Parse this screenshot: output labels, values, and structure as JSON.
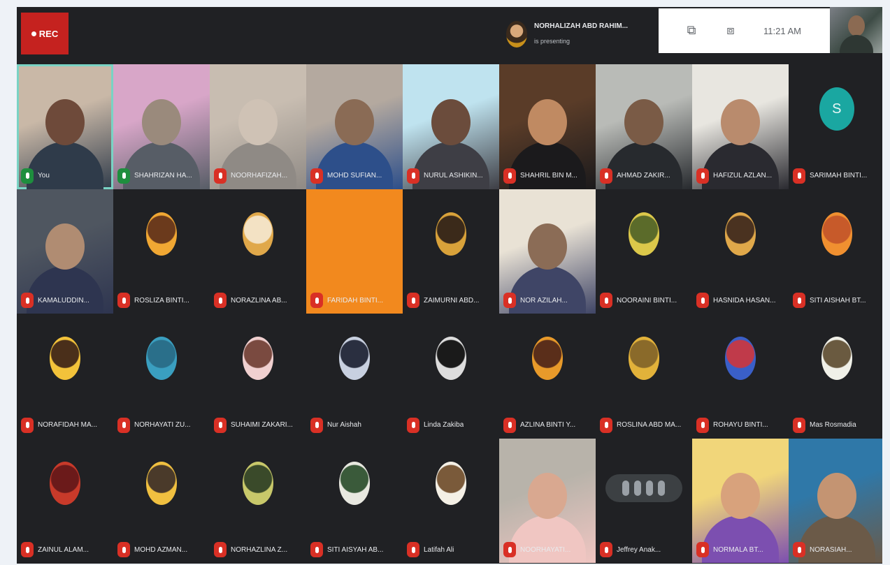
{
  "topbar": {
    "rec_label": "REC",
    "presenter_name": "NORHALIZAH ABD RAHIM...",
    "presenter_status": "is presenting",
    "clock": "11:21 AM",
    "icons": [
      "present-screen-icon",
      "people-icon"
    ]
  },
  "tiles": [
    {
      "name": "You",
      "kind": "video",
      "mic": "on",
      "speaking": true
    },
    {
      "name": "SHAHRIZAN HA...",
      "kind": "video",
      "mic": "on"
    },
    {
      "name": "NOORHAFIZAH...",
      "kind": "video",
      "mic": "off"
    },
    {
      "name": "MOHD SUFIAN...",
      "kind": "video",
      "mic": "off"
    },
    {
      "name": "NURUL ASHIKIN...",
      "kind": "video",
      "mic": "off"
    },
    {
      "name": "SHAHRIL BIN M...",
      "kind": "video",
      "mic": "off"
    },
    {
      "name": "AHMAD ZAKIR...",
      "kind": "video",
      "mic": "off"
    },
    {
      "name": "HAFIZUL AZLAN...",
      "kind": "video",
      "mic": "off"
    },
    {
      "name": "SARIMAH BINTI...",
      "kind": "letter",
      "letter": "S",
      "mic": "off"
    },
    {
      "name": "KAMALUDDIN...",
      "kind": "video",
      "mic": "off"
    },
    {
      "name": "ROSLIZA BINTI...",
      "kind": "avatar",
      "mic": "off"
    },
    {
      "name": "NORAZLINA AB...",
      "kind": "avatar",
      "mic": "off"
    },
    {
      "name": "FARIDAH BINTI...",
      "kind": "orange",
      "mic": "off"
    },
    {
      "name": "ZAIMURNI ABD...",
      "kind": "avatar",
      "mic": "off"
    },
    {
      "name": "NOR AZILAH...",
      "kind": "video",
      "mic": "off"
    },
    {
      "name": "NOORAINI BINTI...",
      "kind": "avatar",
      "mic": "off"
    },
    {
      "name": "HASNIDA HASAN...",
      "kind": "avatar",
      "mic": "off"
    },
    {
      "name": "SITI AISHAH BT...",
      "kind": "avatar",
      "mic": "off"
    },
    {
      "name": "NORAFIDAH MA...",
      "kind": "avatar",
      "mic": "off"
    },
    {
      "name": "NORHAYATI ZU...",
      "kind": "avatar",
      "mic": "off"
    },
    {
      "name": "SUHAIMI ZAKARI...",
      "kind": "avatar",
      "mic": "off"
    },
    {
      "name": "Nur Aishah",
      "kind": "avatar",
      "mic": "off"
    },
    {
      "name": "Linda Zakiba",
      "kind": "avatar",
      "mic": "off"
    },
    {
      "name": "AZLINA BINTI Y...",
      "kind": "avatar",
      "mic": "off"
    },
    {
      "name": "ROSLINA ABD MA...",
      "kind": "avatar",
      "mic": "off"
    },
    {
      "name": "ROHAYU BINTI...",
      "kind": "avatar",
      "mic": "off"
    },
    {
      "name": "Mas Rosmadia",
      "kind": "avatar",
      "mic": "off"
    },
    {
      "name": "ZAINUL ALAM...",
      "kind": "avatar",
      "mic": "off"
    },
    {
      "name": "MOHD AZMAN...",
      "kind": "avatar",
      "mic": "off"
    },
    {
      "name": "NORHAZLINA Z...",
      "kind": "avatar",
      "mic": "off"
    },
    {
      "name": "SITI AISYAH AB...",
      "kind": "avatar",
      "mic": "off"
    },
    {
      "name": "Latifah Ali",
      "kind": "avatar",
      "mic": "off"
    },
    {
      "name": "NOORHAYATI...",
      "kind": "video",
      "mic": "off"
    },
    {
      "name": "Jeffrey Anak...",
      "kind": "dots",
      "mic": "off"
    },
    {
      "name": "NORMALA BT...",
      "kind": "video",
      "mic": "off"
    },
    {
      "name": "NORASIAH...",
      "kind": "video",
      "mic": "off"
    }
  ],
  "colors": {
    "meeting_bg": "#202124",
    "rec_red": "#c5221f",
    "mic_off_red": "#d93025",
    "mic_on_green": "#1e8e3e",
    "speaking_outline": "#79d3c4",
    "letter_avatar": "#1aa7a1",
    "camera_off_orange": "#f2891e"
  }
}
